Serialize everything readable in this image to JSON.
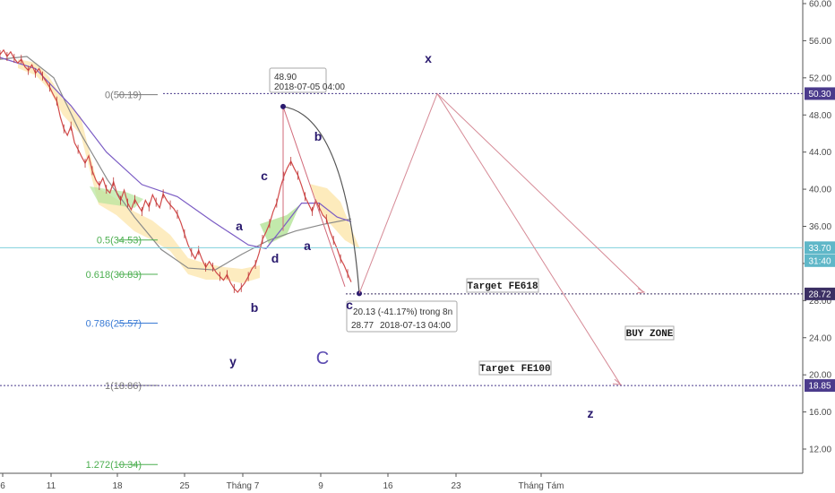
{
  "chart_data": {
    "type": "line",
    "ylim": [
      10,
      60
    ],
    "y_ticks": [
      "60.00",
      "56.00",
      "52.00",
      "48.00",
      "44.00",
      "40.00",
      "36.00",
      "32.00",
      "28.00",
      "24.00",
      "20.00",
      "16.00",
      "12.00"
    ],
    "x_ticks": [
      "6",
      "11",
      "18",
      "25",
      "Tháng 7",
      "9",
      "16",
      "23",
      "Tháng Tám"
    ],
    "price_tags": [
      {
        "label": "50.30",
        "value": 50.3,
        "color": "#4b3b8c"
      },
      {
        "label": "33.70",
        "value": 33.7,
        "color": "#5fb7c8"
      },
      {
        "label": "31:40",
        "value": 32.3,
        "color": "#5fb7c8"
      },
      {
        "label": "28.72",
        "value": 28.72,
        "color": "#3b2f63"
      },
      {
        "label": "18.85",
        "value": 18.85,
        "color": "#4b3b8c"
      }
    ],
    "fib_levels": [
      {
        "label": "0(50.19)",
        "value": 50.19,
        "color": "#7a7a7a"
      },
      {
        "label": "0.5(34.53)",
        "value": 34.53,
        "color": "#4caf50"
      },
      {
        "label": "0.618(30.83)",
        "value": 30.83,
        "color": "#4caf50"
      },
      {
        "label": "0.786(25.57)",
        "value": 25.57,
        "color": "#3a7bd5"
      },
      {
        "label": "1(18.86)",
        "value": 18.86,
        "color": "#7a7a7a"
      },
      {
        "label": "1.272(10.34)",
        "value": 10.34,
        "color": "#4caf50"
      }
    ],
    "price_series": [
      [
        0,
        54.5
      ],
      [
        2,
        55
      ],
      [
        4,
        54.3
      ],
      [
        6,
        54.8
      ],
      [
        8,
        54.1
      ],
      [
        10,
        53.6
      ],
      [
        12,
        54
      ],
      [
        14,
        53.2
      ],
      [
        16,
        52.8
      ],
      [
        18,
        53.4
      ],
      [
        20,
        52.5
      ],
      [
        22,
        53
      ],
      [
        24,
        52.2
      ],
      [
        26,
        51.6
      ],
      [
        28,
        51
      ],
      [
        30,
        50.2
      ],
      [
        32,
        49.5
      ],
      [
        34,
        47.8
      ],
      [
        36,
        46.5
      ],
      [
        38,
        45.8
      ],
      [
        40,
        46.8
      ],
      [
        42,
        45
      ],
      [
        44,
        44.3
      ],
      [
        46,
        43.5
      ],
      [
        48,
        42.8
      ],
      [
        50,
        43.6
      ],
      [
        52,
        42
      ],
      [
        54,
        41
      ],
      [
        56,
        40.4
      ],
      [
        58,
        41.2
      ],
      [
        60,
        40
      ],
      [
        62,
        39.6
      ],
      [
        64,
        40.8
      ],
      [
        66,
        39.5
      ],
      [
        68,
        38.8
      ],
      [
        70,
        39.9
      ],
      [
        72,
        38.5
      ],
      [
        74,
        37.8
      ],
      [
        76,
        38.9
      ],
      [
        78,
        38.2
      ],
      [
        80,
        37.6
      ],
      [
        82,
        38.8
      ],
      [
        84,
        38.1
      ],
      [
        86,
        39.4
      ],
      [
        88,
        38.6
      ],
      [
        90,
        38
      ],
      [
        92,
        39.5
      ],
      [
        94,
        38.8
      ],
      [
        96,
        38.3
      ],
      [
        98,
        37.9
      ],
      [
        100,
        37.3
      ],
      [
        102,
        36.4
      ],
      [
        104,
        35.2
      ],
      [
        106,
        34
      ],
      [
        108,
        33.2
      ],
      [
        110,
        32.5
      ],
      [
        112,
        33.4
      ],
      [
        114,
        32.4
      ],
      [
        116,
        31.6
      ],
      [
        118,
        32.2
      ],
      [
        120,
        31.6
      ],
      [
        122,
        31
      ],
      [
        124,
        30.6
      ],
      [
        126,
        30.2
      ],
      [
        128,
        30.8
      ],
      [
        130,
        29.9
      ],
      [
        132,
        29.3
      ],
      [
        134,
        28.9
      ],
      [
        136,
        29.4
      ],
      [
        138,
        29.9
      ],
      [
        140,
        30.6
      ],
      [
        142,
        31.4
      ],
      [
        144,
        31.9
      ],
      [
        146,
        33.1
      ],
      [
        148,
        34.6
      ],
      [
        150,
        35.4
      ],
      [
        152,
        36.3
      ],
      [
        154,
        37.6
      ],
      [
        156,
        38.5
      ],
      [
        158,
        40.1
      ],
      [
        160,
        41.4
      ],
      [
        162,
        42.3
      ],
      [
        164,
        43
      ],
      [
        166,
        42.2
      ],
      [
        168,
        41.5
      ],
      [
        170,
        40.4
      ],
      [
        172,
        39.2
      ],
      [
        174,
        38.4
      ],
      [
        176,
        37.6
      ],
      [
        178,
        38.8
      ],
      [
        180,
        38
      ],
      [
        182,
        37.2
      ],
      [
        184,
        36.8
      ],
      [
        186,
        35.5
      ],
      [
        188,
        34.5
      ],
      [
        190,
        33.6
      ],
      [
        192,
        32.5
      ],
      [
        194,
        31.8
      ],
      [
        196,
        30.9
      ],
      [
        198,
        30
      ]
    ],
    "price_x_range": [
      0,
      198
    ],
    "price_px_range": [
      0,
      392
    ],
    "ma_fast": [
      [
        0,
        54.2
      ],
      [
        20,
        53
      ],
      [
        40,
        49
      ],
      [
        60,
        44
      ],
      [
        80,
        40.5
      ],
      [
        100,
        39.2
      ],
      [
        120,
        36.5
      ],
      [
        140,
        34
      ],
      [
        150,
        33.6
      ],
      [
        160,
        36
      ],
      [
        170,
        38.5
      ],
      [
        180,
        38.5
      ],
      [
        190,
        37
      ],
      [
        198,
        36.5
      ]
    ],
    "ma_slow": [
      [
        0,
        54
      ],
      [
        30,
        54.3
      ],
      [
        60,
        52
      ],
      [
        90,
        46
      ],
      [
        120,
        41
      ],
      [
        150,
        37
      ],
      [
        180,
        33.5
      ],
      [
        210,
        31.5
      ],
      [
        240,
        31.3
      ],
      [
        270,
        33
      ],
      [
        300,
        34.5
      ],
      [
        330,
        35.5
      ],
      [
        360,
        36.2
      ],
      [
        392,
        36.8
      ]
    ],
    "ma_slow_px": true,
    "annotations": {
      "top_tip": {
        "price": "48.90",
        "time": "2018-07-05 04:00"
      },
      "bottom_tip": {
        "change": "20.13 (-41.17%) trong 8n",
        "price": "28.77",
        "time": "2018-07-13 04:00"
      },
      "wave_labels": [
        {
          "text": "x",
          "px": [
            478,
            70
          ]
        },
        {
          "text": "b",
          "px": [
            355,
            157
          ]
        },
        {
          "text": "c",
          "px": [
            295,
            201
          ]
        },
        {
          "text": "a",
          "px": [
            267,
            257
          ]
        },
        {
          "text": "d",
          "px": [
            307,
            293
          ]
        },
        {
          "text": "a",
          "px": [
            343,
            279
          ]
        },
        {
          "text": "b",
          "px": [
            284,
            348
          ]
        },
        {
          "text": "c",
          "px": [
            390,
            345
          ]
        },
        {
          "text": "y",
          "px": [
            260,
            408
          ]
        },
        {
          "text": "z",
          "px": [
            659,
            466
          ]
        }
      ],
      "big_c": "C",
      "target_fe618": "Target FE618",
      "target_fe100": "Target FE100",
      "buy_zone": "BUY ZONE"
    }
  }
}
